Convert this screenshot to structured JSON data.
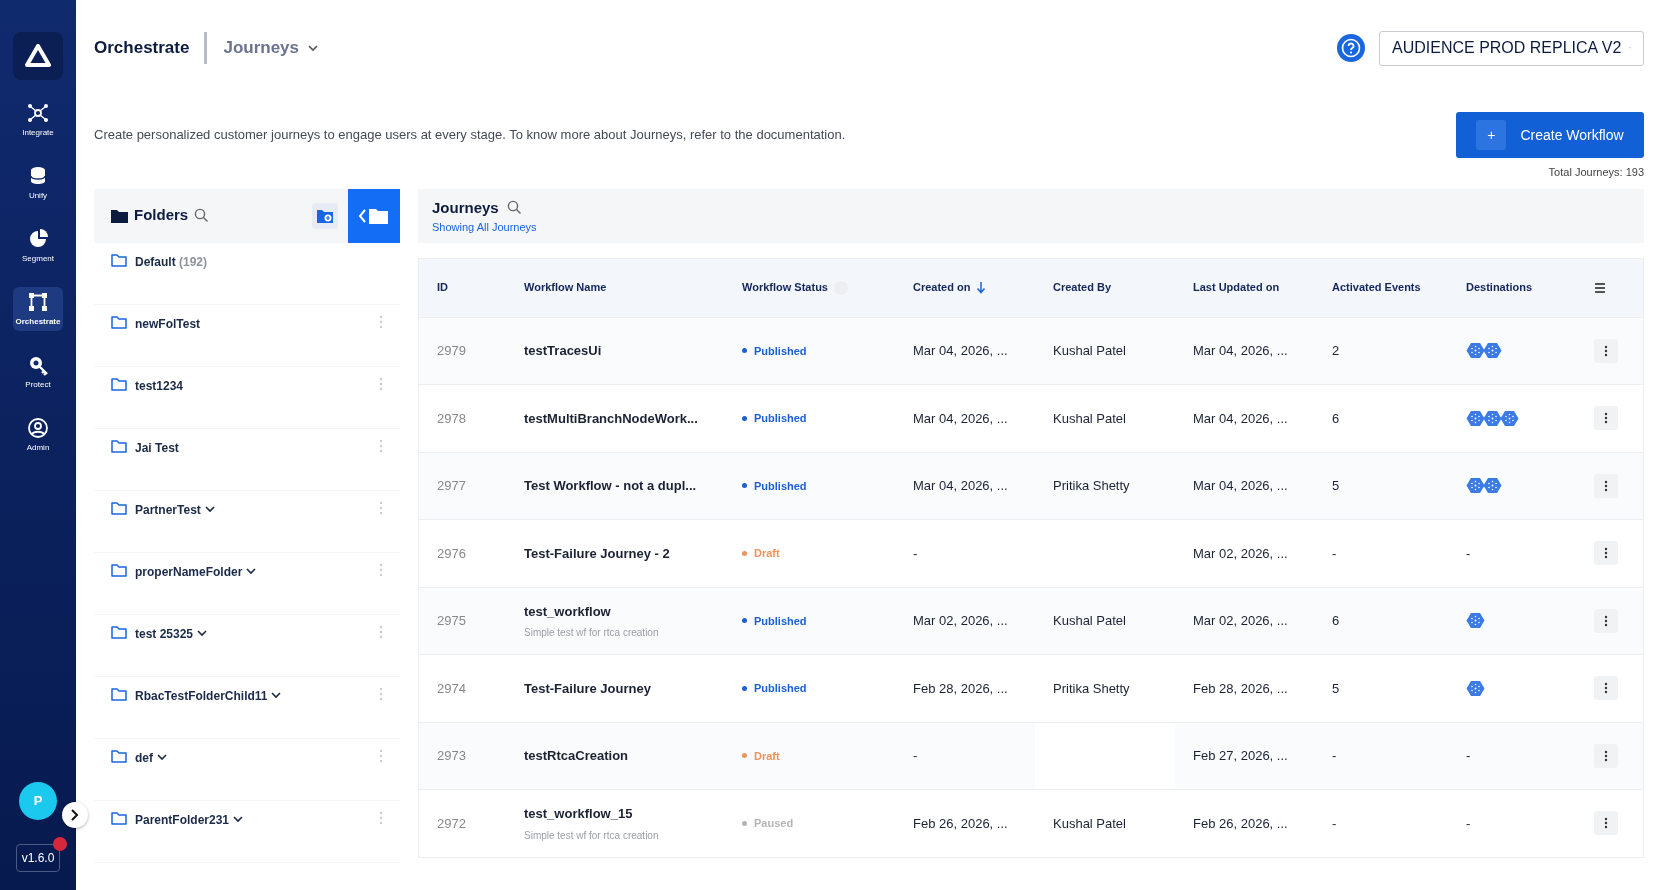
{
  "nav": [
    {
      "label": "Integrate",
      "selected": false
    },
    {
      "label": "Unify",
      "selected": false
    },
    {
      "label": "Segment",
      "selected": false
    },
    {
      "label": "Orchestrate",
      "selected": true
    },
    {
      "label": "Protect",
      "selected": false
    },
    {
      "label": "Admin",
      "selected": false
    }
  ],
  "user_initial": "P",
  "version": "v1.6.0",
  "header": {
    "module": "Orchestrate",
    "page": "Journeys",
    "workspace": "AUDIENCE PROD REPLICA V2"
  },
  "description": "Create personalized customer journeys to engage users at every stage. To know more about Journeys, refer to the documentation.",
  "create_button": {
    "icon": "+",
    "label": "Create Workflow"
  },
  "total": "Total Journeys: 193",
  "folders": {
    "title": "Folders",
    "items": [
      {
        "name": "Default",
        "count": "(192)",
        "expandable": false,
        "menu": false
      },
      {
        "name": "newFolTest",
        "expandable": false,
        "menu": true
      },
      {
        "name": "test1234",
        "expandable": false,
        "menu": true
      },
      {
        "name": "Jai Test",
        "expandable": false,
        "menu": true
      },
      {
        "name": "PartnerTest",
        "expandable": true,
        "menu": true
      },
      {
        "name": "properNameFolder",
        "expandable": true,
        "menu": true
      },
      {
        "name": "test 25325",
        "expandable": true,
        "menu": true
      },
      {
        "name": "RbacTestFolderChild11",
        "expandable": true,
        "menu": true
      },
      {
        "name": "def",
        "expandable": true,
        "menu": true
      },
      {
        "name": "ParentFolder231",
        "expandable": true,
        "menu": true
      }
    ]
  },
  "journeys": {
    "title": "Journeys",
    "subtitle": "Showing All Journeys",
    "columns": [
      "ID",
      "Workflow Name",
      "Workflow Status",
      "Created on",
      "Created By",
      "Last Updated on",
      "Activated Events",
      "Destinations"
    ],
    "rows": [
      {
        "id": "2979",
        "name": "testTracesUi",
        "status": {
          "label": "Published",
          "color": "#1a5fd6"
        },
        "created_on": "Mar 04, 2026, ...",
        "created_by": "Kushal Patel",
        "updated_on": "Mar 04, 2026, ...",
        "events": "2",
        "destinations": [
          {
            "kind": "hex"
          },
          {
            "kind": "hex"
          }
        ]
      },
      {
        "id": "2978",
        "name": "testMultiBranchNodeWork...",
        "status": {
          "label": "Published",
          "color": "#1a5fd6"
        },
        "created_on": "Mar 04, 2026, ...",
        "created_by": "Kushal Patel",
        "updated_on": "Mar 04, 2026, ...",
        "events": "6",
        "destinations": [
          {
            "kind": "hex"
          },
          {
            "kind": "hex"
          },
          {
            "kind": "hex"
          }
        ]
      },
      {
        "id": "2977",
        "name": "Test Workflow - not a dupl...",
        "status": {
          "label": "Published",
          "color": "#1a5fd6"
        },
        "created_on": "Mar 04, 2026, ...",
        "created_by": "Pritika Shetty",
        "updated_on": "Mar 04, 2026, ...",
        "events": "5",
        "destinations": [
          {
            "kind": "hex"
          },
          {
            "kind": "hex"
          }
        ]
      },
      {
        "id": "2976",
        "name": "Test-Failure Journey - 2",
        "status": {
          "label": "Draft",
          "color": "#f0935a"
        },
        "created_on": "-",
        "updated_on": "Mar 02, 2026, ...",
        "events": "-",
        "destinations_text": "-"
      },
      {
        "id": "2975",
        "name": "test_workflow",
        "description": "Simple test wf for rtca creation",
        "status": {
          "label": "Published",
          "color": "#1a5fd6"
        },
        "created_on": "Mar 02, 2026, ...",
        "created_by": "Kushal Patel",
        "updated_on": "Mar 02, 2026, ...",
        "events": "6",
        "destinations": [
          {
            "kind": "hex"
          }
        ]
      },
      {
        "id": "2974",
        "name": "Test-Failure Journey",
        "status": {
          "label": "Published",
          "color": "#1a5fd6"
        },
        "created_on": "Feb 28, 2026, ...",
        "created_by": "Pritika Shetty",
        "updated_on": "Feb 28, 2026, ...",
        "events": "5",
        "destinations": [
          {
            "kind": "hex"
          }
        ]
      },
      {
        "id": "2973",
        "name": "testRtcaCreation",
        "status": {
          "label": "Draft",
          "color": "#f0935a"
        },
        "created_on": "-",
        "updated_on": "Feb 27, 2026, ...",
        "events": "-",
        "destinations_text": "-"
      },
      {
        "id": "2972",
        "name": "test_workflow_15",
        "description": "Simple test wf for rtca creation",
        "status": {
          "label": "Paused",
          "color": "#b4b4b4"
        },
        "created_on": "Feb 26, 2026, ...",
        "created_by": "Kushal Patel",
        "updated_on": "Feb 26, 2026, ...",
        "events": "-",
        "destinations_text": "-"
      }
    ]
  }
}
